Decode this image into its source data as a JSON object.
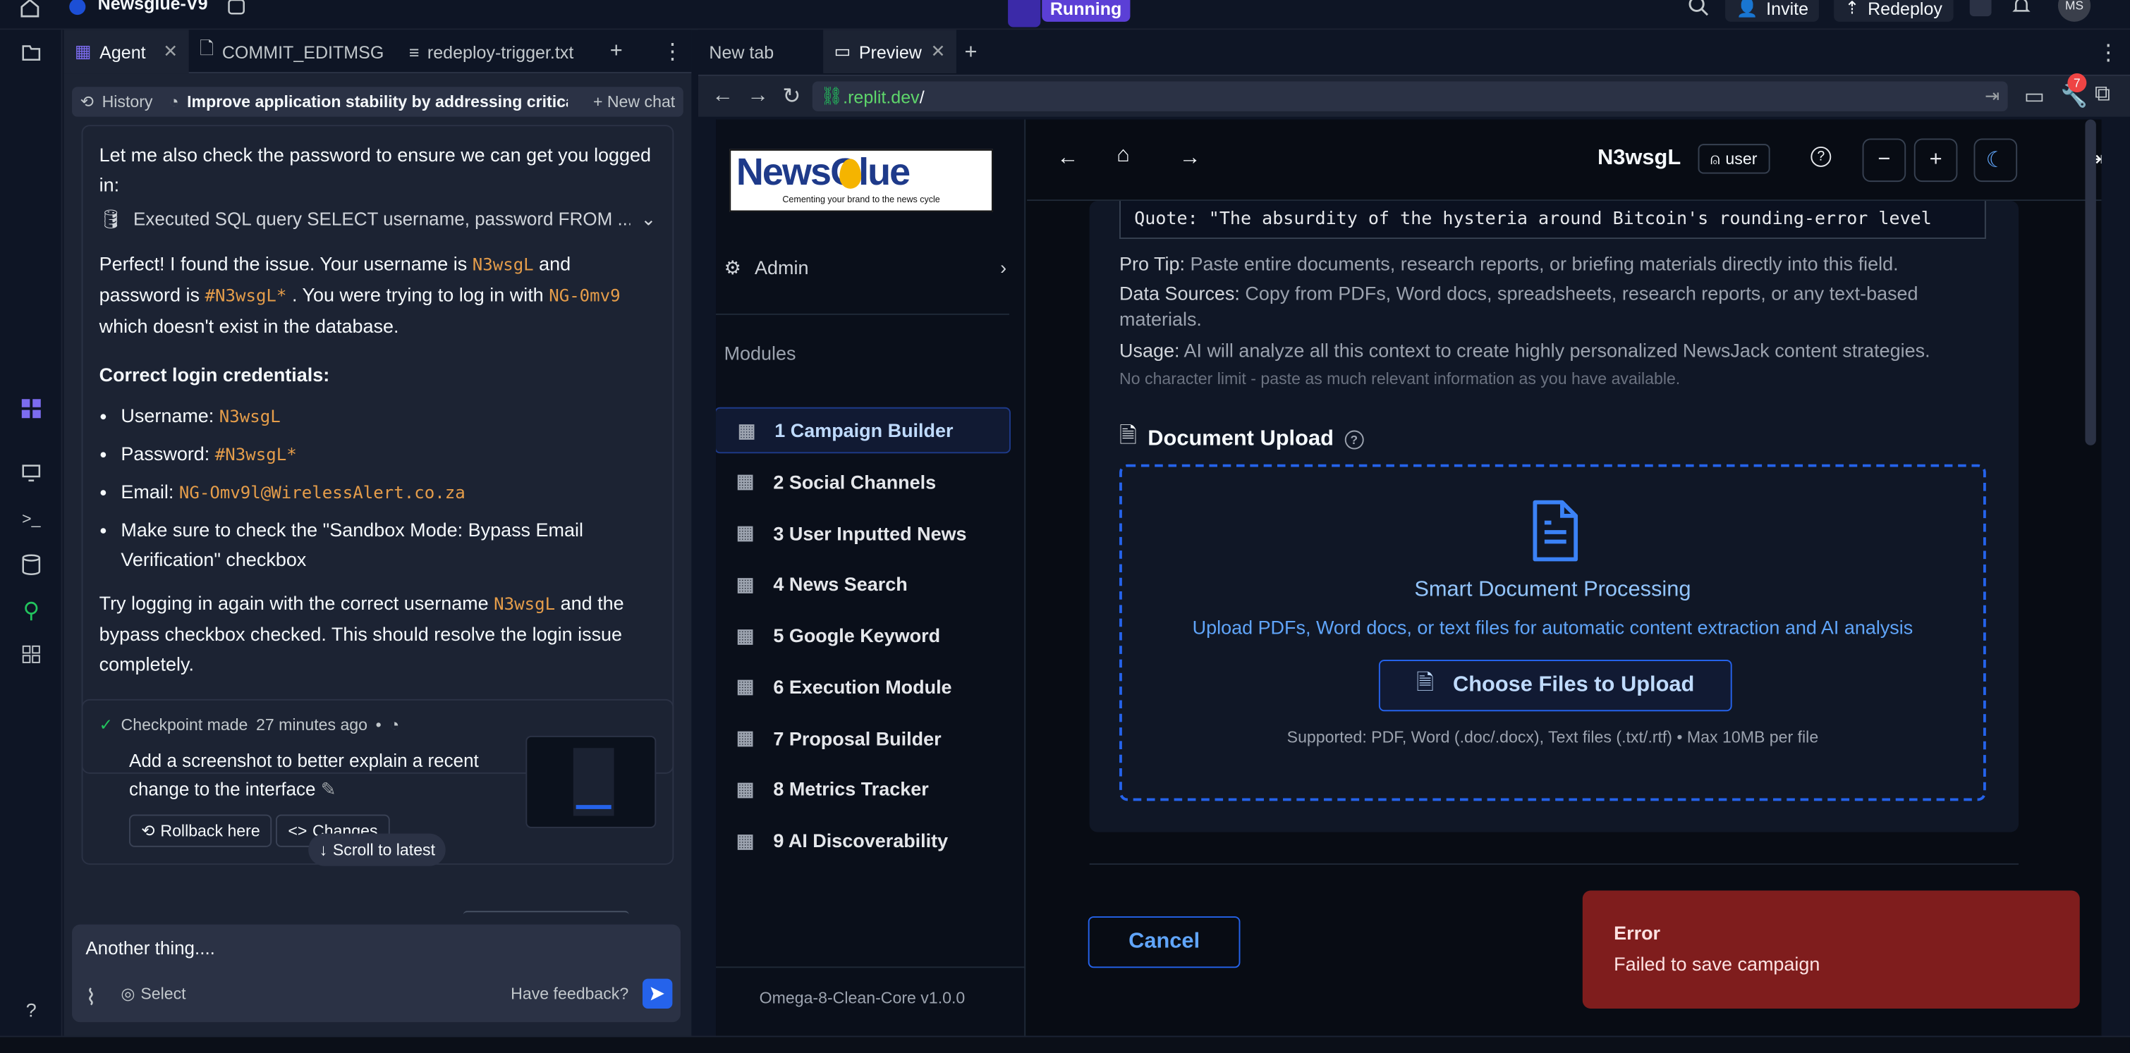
{
  "topbar": {
    "project_name": "Newsglue-V9",
    "run_status": "Running",
    "invite_label": "Invite",
    "redeploy_label": "Redeploy",
    "avatar_initials": "MS"
  },
  "agent_tabs": [
    {
      "label": "Agent"
    },
    {
      "label": "COMMIT_EDITMSG"
    },
    {
      "label": "redeploy-trigger.txt"
    }
  ],
  "agent_subbar": {
    "history_label": "History",
    "thread_title": "Improve application stability by addressing critical ...",
    "new_chat_label": "New chat"
  },
  "chat": {
    "intro": "Let me also check the password to ensure we can get you logged in:",
    "sql_line": "Executed SQL query SELECT username, password FROM ...",
    "found_p1": "Perfect! I found the issue. Your username is",
    "found_user": "N3wsgL",
    "found_p2": "and password is",
    "found_pass": "#N3wsgL*",
    "found_p3": ". You were trying to log in with",
    "found_wrong": "NG-0mv9",
    "found_p4": "which doesn't exist in the database.",
    "creds_heading": "Correct login credentials:",
    "username_label": "Username:",
    "username_value": "N3wsgL",
    "password_label": "Password:",
    "password_value": "#N3wsgL*",
    "email_label": "Email:",
    "email_value": "NG-Omv9l@WirelessAlert.co.za",
    "sandbox_note": "Make sure to check the \"Sandbox Mode: Bypass Email Verification\" checkbox",
    "retry_p1": "Try logging in again with the correct username",
    "retry_user": "N3wsgL",
    "retry_p2": "and the bypass checkbox checked. This should resolve the login issue completely."
  },
  "checkpoint": {
    "made": "Checkpoint made",
    "ago": "27 minutes ago",
    "bullet": "•",
    "description": "Add a screenshot to better explain a recent change to the interface",
    "rollback_label": "Rollback here",
    "changes_label": "Changes",
    "scroll_label": "Scroll to latest"
  },
  "composer": {
    "input_value": "Another thing....",
    "select_label": "Select",
    "feedback_label": "Have feedback?"
  },
  "right_tabs": [
    {
      "label": "New tab"
    },
    {
      "label": "Preview"
    }
  ],
  "address": {
    "url_prefix": ".replit.dev",
    "url_suffix": "/",
    "badge_count": "7"
  },
  "app": {
    "logo_text": "NewsGlue",
    "logo_tagline": "Cementing your brand to the news cycle",
    "admin_label": "Admin",
    "modules_heading": "Modules",
    "modules": [
      {
        "label": "1 Campaign Builder",
        "active": true
      },
      {
        "label": "2 Social Channels"
      },
      {
        "label": "3 User Inputted News"
      },
      {
        "label": "4 News Search"
      },
      {
        "label": "5 Google Keyword"
      },
      {
        "label": "6 Execution Module"
      },
      {
        "label": "7 Proposal Builder"
      },
      {
        "label": "8 Metrics Tracker"
      },
      {
        "label": "9 AI Discoverability"
      }
    ],
    "version": "Omega-8-Clean-Core v1.0.0",
    "username": "N3wsgL",
    "role": "user",
    "textarea_excerpt": "Quote: \"The absurdity of the hysteria around Bitcoin's rounding-error level",
    "pro_tip_label": "Pro Tip:",
    "pro_tip_text": "Paste entire documents, research reports, or briefing materials directly into this field.",
    "sources_label": "Data Sources:",
    "sources_text": "Copy from PDFs, Word docs, spreadsheets, research reports, or any text-based materials.",
    "usage_label": "Usage:",
    "usage_text": "AI will analyze all this context to create highly personalized NewsJack content strategies.",
    "no_limit": "No character limit - paste as much relevant information as you have available.",
    "upload_title": "Document Upload",
    "upload_heading": "Smart Document Processing",
    "upload_sub": "Upload PDFs, Word docs, or text files for automatic content extraction and AI analysis",
    "upload_button": "Choose Files to Upload",
    "upload_supported": "Supported: PDF, Word (.doc/.docx), Text files (.txt/.rtf) • Max 10MB per file",
    "cancel_label": "Cancel"
  },
  "toast": {
    "title": "Error",
    "message": "Failed to save campaign"
  },
  "colors": {
    "accent_blue": "#3b82f6",
    "error_red": "#7f1d1d",
    "running_purple": "#5b3fd6",
    "code_orange": "#e59d4a"
  }
}
